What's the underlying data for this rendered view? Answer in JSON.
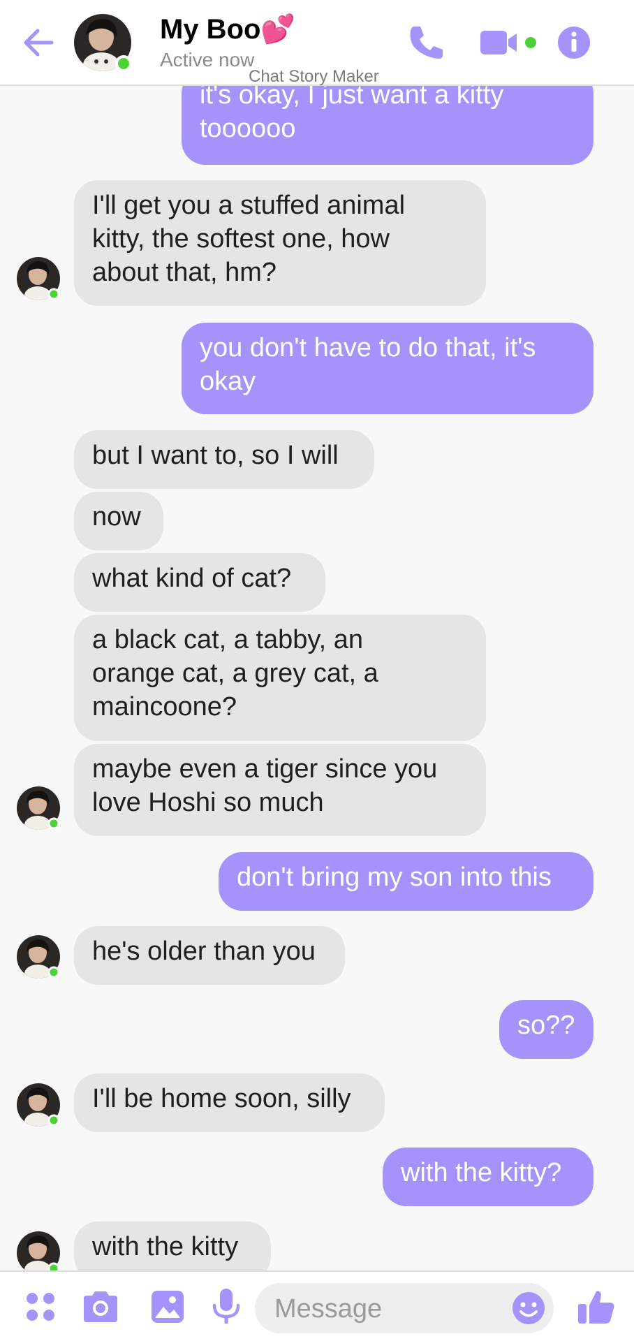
{
  "header": {
    "back_icon": "arrow-left-icon",
    "contact_name": "My Boo💕",
    "status": "Active now",
    "watermark": "Chat Story Maker",
    "call_icon": "phone-icon",
    "video_icon": "video-camera-icon",
    "info_icon": "info-icon",
    "online_color": "#4cd137"
  },
  "messages": [
    {
      "side": "out",
      "text": "it's okay, I just want a kitty\ntoooooo"
    },
    {
      "side": "in",
      "text": "I'll get you a stuffed animal\nkitty, the softest one, how\nabout that, hm?"
    },
    {
      "side": "out",
      "text": "you don't have to do that, it's\nokay"
    },
    {
      "side": "in",
      "text": "but I want to, so I will"
    },
    {
      "side": "in",
      "text": "now"
    },
    {
      "side": "in",
      "text": "what kind of cat?"
    },
    {
      "side": "in",
      "text": "a black cat, a tabby, an\norange cat, a grey cat, a\nmaincoone?"
    },
    {
      "side": "in",
      "text": "maybe even a tiger since you\nlove Hoshi so much"
    },
    {
      "side": "out",
      "text": "don't bring my son into this"
    },
    {
      "side": "in",
      "text": "he's older than you"
    },
    {
      "side": "out",
      "text": "so??"
    },
    {
      "side": "in",
      "text": "I'll be home soon, silly"
    },
    {
      "side": "out",
      "text": "with the kitty?"
    },
    {
      "side": "in",
      "text": "with the kitty"
    }
  ],
  "composer": {
    "apps_icon": "apps-icon",
    "camera_icon": "camera-icon",
    "gallery_icon": "image-icon",
    "mic_icon": "microphone-icon",
    "placeholder": "Message",
    "emoji_icon": "smiley-icon",
    "like_icon": "thumbs-up-icon"
  },
  "colors": {
    "accent": "#a593fb",
    "incoming_bubble": "#e5e5e5",
    "outgoing_bubble": "#a593fb"
  }
}
